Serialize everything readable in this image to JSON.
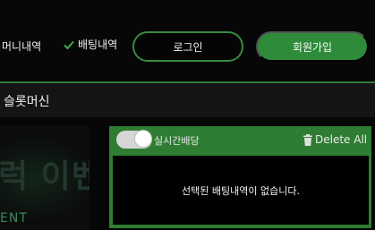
{
  "header": {
    "nav_money": "머니내역",
    "nav_betting": "배팅내역",
    "login_label": "로그인",
    "signup_label": "회원가입"
  },
  "section": {
    "title": "슬롯머신"
  },
  "banner": {
    "text": "럭 이벤",
    "sub": "ENT"
  },
  "bet_panel": {
    "live_label": "실시간배당",
    "live_toggle_on": true,
    "delete_all_label": "Delete All",
    "empty_message": "선택된 배팅내역이 없습니다."
  },
  "colors": {
    "accent": "#2e7d32",
    "button_green": "#2e8b3a",
    "check": "#3fae4a"
  },
  "icons": {
    "betting": "check-icon",
    "delete": "trash-icon"
  }
}
